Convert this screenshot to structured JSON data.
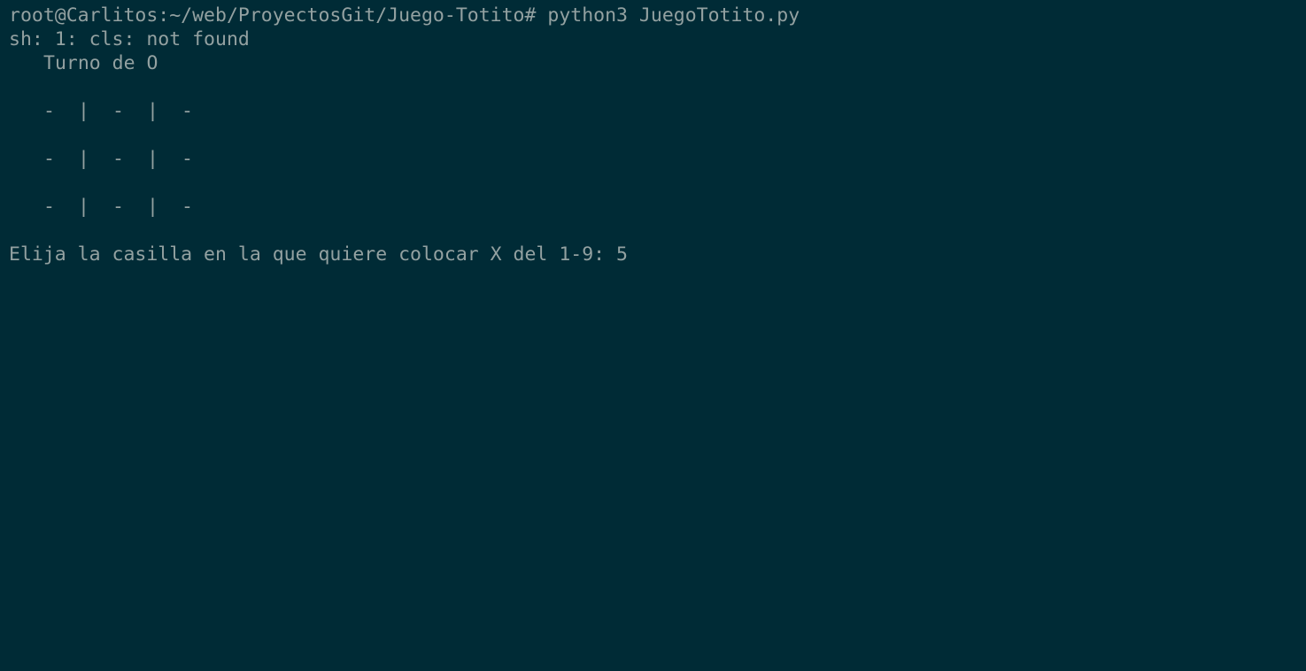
{
  "terminal": {
    "command_line": "root@Carlitos:~/web/ProyectosGit/Juego-Totito# python3 JuegoTotito.py",
    "error_line": "sh: 1: cls: not found",
    "turn_line": "Turno de O",
    "board": [
      [
        "-",
        "-",
        "-"
      ],
      [
        "-",
        "-",
        "-"
      ],
      [
        "-",
        "-",
        "-"
      ]
    ],
    "separator": "|",
    "prompt_text": "Elija la casilla en la que quiere colocar X del 1-9: ",
    "input_value": "5"
  },
  "colors": {
    "background": "#002b36",
    "foreground": "#93a1a1"
  }
}
